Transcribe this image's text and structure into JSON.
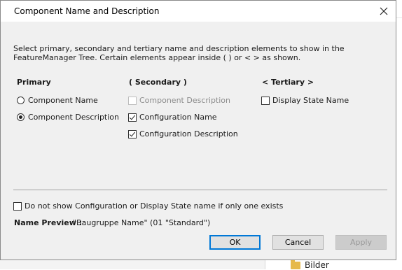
{
  "background": {
    "folder_label": "Bilder"
  },
  "dialog": {
    "title": "Component Name and Description",
    "description": "Select primary, secondary and tertiary name and description elements to show in the FeatureManager Tree. Certain elements appear inside ( ) or < > as shown.",
    "primary": {
      "heading": "Primary",
      "options": [
        {
          "label": "Component Name",
          "selected": false
        },
        {
          "label": "Component Description",
          "selected": true
        }
      ]
    },
    "secondary": {
      "heading": "( Secondary )",
      "options": [
        {
          "label": "Component Description",
          "checked": false,
          "enabled": false
        },
        {
          "label": "Configuration Name",
          "checked": true,
          "enabled": true
        },
        {
          "label": "Configuration Description",
          "checked": true,
          "enabled": true
        }
      ]
    },
    "tertiary": {
      "heading": "< Tertiary >",
      "options": [
        {
          "label": "Display State Name",
          "checked": false,
          "enabled": true
        }
      ]
    },
    "hide_option": {
      "label": "Do not show Configuration or Display State name if only one exists",
      "checked": false
    },
    "preview": {
      "label": "Name Preview :",
      "value": "\"Baugruppe Name\" (01 \"Standard\")"
    },
    "buttons": {
      "ok": "OK",
      "cancel": "Cancel",
      "apply": "Apply"
    }
  }
}
